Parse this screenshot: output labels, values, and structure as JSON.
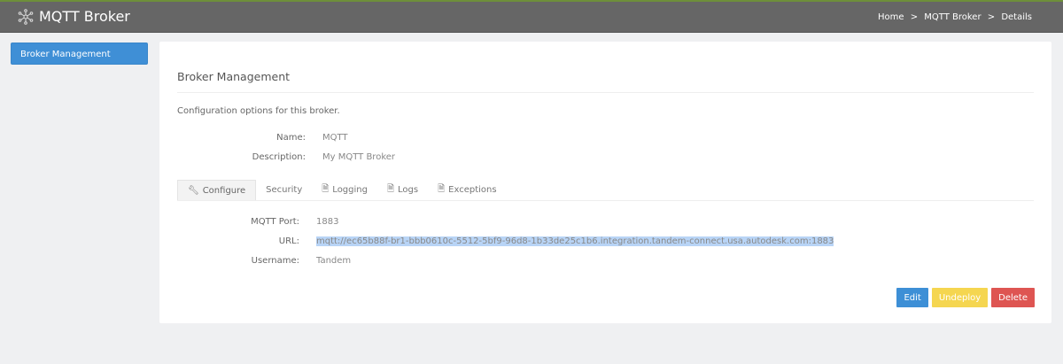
{
  "header": {
    "title": "MQTT Broker",
    "breadcrumb": [
      "Home",
      "MQTT Broker",
      "Details"
    ],
    "separator": ">"
  },
  "sidebar": {
    "items": [
      {
        "label": "Broker Management"
      }
    ]
  },
  "main": {
    "title": "Broker Management",
    "description": "Configuration options for this broker.",
    "name_label": "Name:",
    "name_value": "MQTT",
    "desc_label": "Description:",
    "desc_value": "My MQTT Broker",
    "tabs": [
      {
        "label": "Configure",
        "icon": "wrench-icon"
      },
      {
        "label": "Security"
      },
      {
        "label": "Logging",
        "icon": "document-icon"
      },
      {
        "label": "Logs",
        "icon": "document-icon"
      },
      {
        "label": "Exceptions",
        "icon": "document-icon"
      }
    ],
    "config": {
      "port_label": "MQTT Port:",
      "port_value": "1883",
      "url_label": "URL:",
      "url_value": "mqtt://ec65b88f-br1-bbb0610c-5512-5bf9-96d8-1b33de25c1b6.integration.tandem-connect.usa.autodesk.com:1883",
      "user_label": "Username:",
      "user_value": "Tandem"
    },
    "buttons": {
      "edit": "Edit",
      "undeploy": "Undeploy",
      "delete": "Delete"
    }
  },
  "colors": {
    "edit": "#3d8fd6",
    "undeploy": "#f5d650",
    "delete": "#de5552"
  }
}
